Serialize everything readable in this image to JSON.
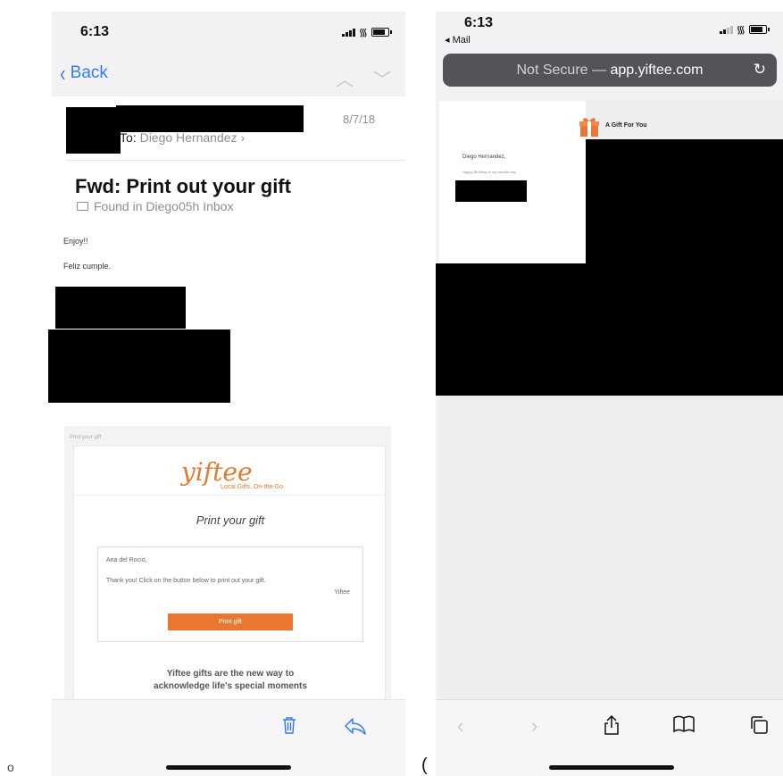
{
  "left": {
    "status": {
      "time": "6:13"
    },
    "nav": {
      "back_label": "Back"
    },
    "mail": {
      "to_prefix": "To:",
      "to_name": "Diego Hernandez",
      "date": "8/7/18",
      "subject": "Fwd:  Print out your gift",
      "found_in": "Found in Diego05h Inbox",
      "body_lines": [
        "Enjoy!!",
        "Feliz cumple."
      ]
    },
    "email_card": {
      "header_note": "Print your gift",
      "logo": "yiftee",
      "tagline": "Local Gifts, On-the-Go",
      "title": "Print your gift",
      "recipient": "Ana del Rocio,",
      "message": "Thank you! Click on the button below to print out your gift.",
      "signature": "Yiftee",
      "button_label": "Print gift",
      "footer_line1": "Yiftee gifts are the new way to",
      "footer_line2": "acknowledge life's special moments"
    }
  },
  "right": {
    "status": {
      "time": "6:13",
      "back_app": "◂ Mail"
    },
    "url": {
      "prefix": "Not Secure —",
      "domain": "app.yiftee.com"
    },
    "page": {
      "gift_label": "A Gift For You",
      "greeting": "Diego Hernandez,",
      "message": "Happy Birthday to my favorite boy"
    }
  },
  "icons": [
    "chevron-left-icon",
    "chevron-up-icon",
    "chevron-down-icon",
    "folder-icon",
    "trash-icon",
    "reply-icon",
    "reload-icon",
    "back-arrow-icon",
    "forward-arrow-icon",
    "share-icon",
    "bookmarks-icon",
    "tabs-icon",
    "gift-icon"
  ],
  "colors": {
    "ios_blue": "#2f7cf6",
    "yiftee_orange": "#e9772f",
    "url_bar": "#545458"
  },
  "stray": {
    "left_glyph": "o",
    "right_glyph": "("
  }
}
